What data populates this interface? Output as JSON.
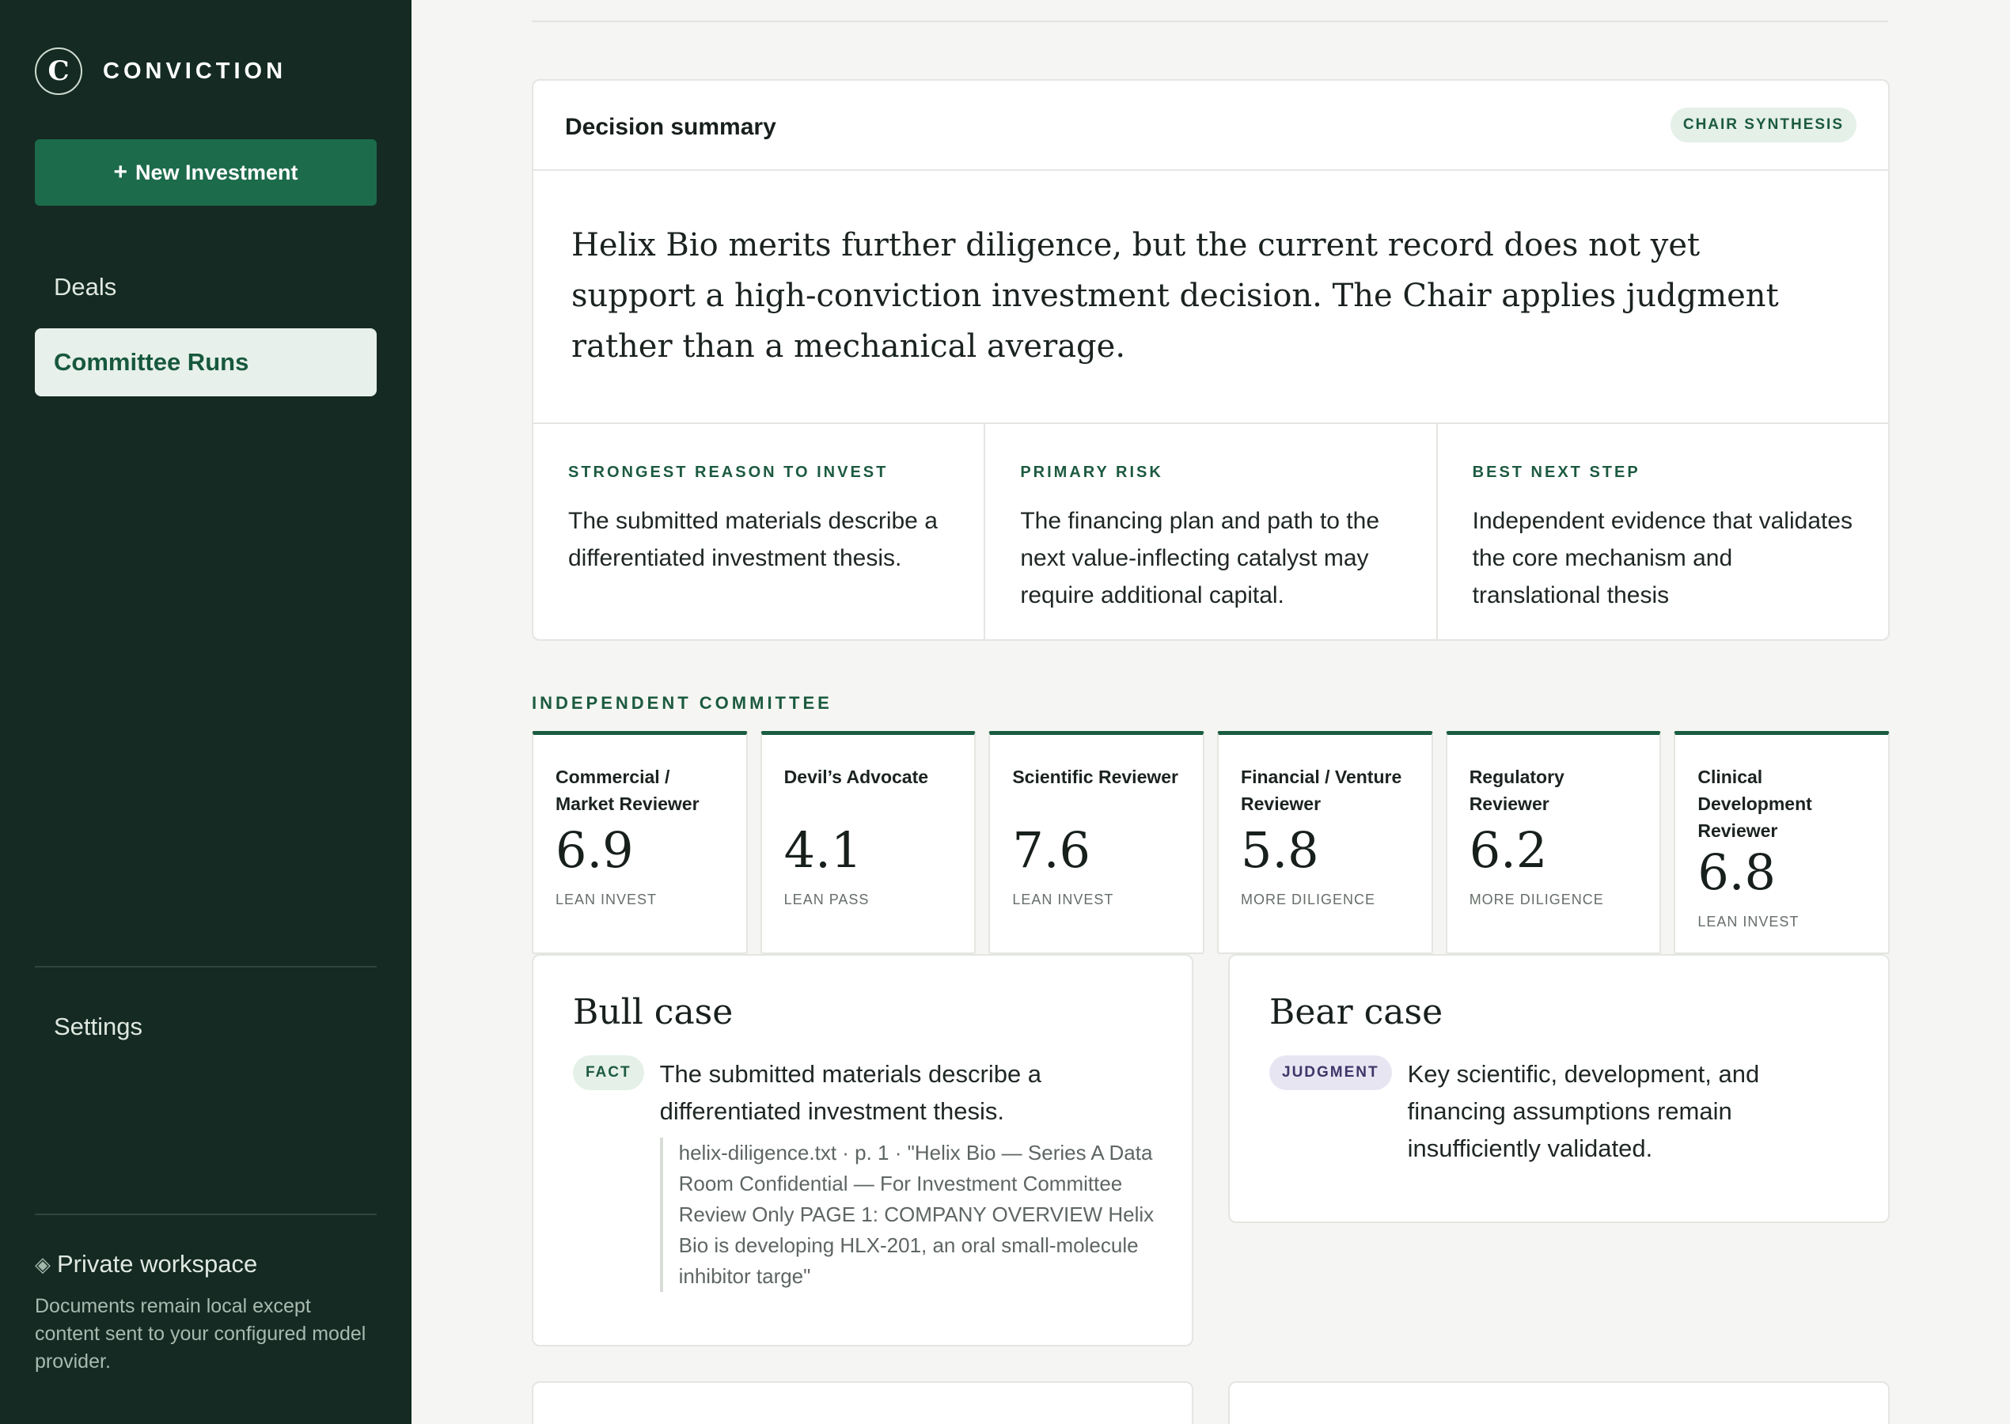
{
  "brand": {
    "mark": "C",
    "name": "CONVICTION"
  },
  "sidebar": {
    "new_button": "New Investment",
    "new_button_icon": "plus-icon",
    "nav": [
      {
        "label": "Deals",
        "active": false
      },
      {
        "label": "Committee Runs",
        "active": true
      }
    ],
    "settings": "Settings",
    "privacy": {
      "icon": "diamond-icon",
      "title": "Private workspace",
      "text": "Documents remain local except content sent to your configured model provider."
    }
  },
  "decision": {
    "title": "Decision summary",
    "badge": "CHAIR SYNTHESIS",
    "summary": "Helix Bio merits further diligence, but the current record does not yet support a high-conviction investment decision. The Chair applies judgment rather than a mechanical average.",
    "columns": [
      {
        "label": "STRONGEST REASON TO INVEST",
        "text": "The submitted materials describe a differentiated investment thesis."
      },
      {
        "label": "PRIMARY RISK",
        "text": "The financing plan and path to the next value-inflecting catalyst may require additional capital."
      },
      {
        "label": "BEST NEXT STEP",
        "text": "Independent evidence that validates the core mechanism and translational thesis"
      }
    ]
  },
  "committee": {
    "label": "INDEPENDENT COMMITTEE",
    "reviewers": [
      {
        "name": "Commercial / Market Reviewer",
        "score": "6.9",
        "verdict": "LEAN INVEST"
      },
      {
        "name": "Devil’s Advocate",
        "score": "4.1",
        "verdict": "LEAN PASS"
      },
      {
        "name": "Scientific Reviewer",
        "score": "7.6",
        "verdict": "LEAN INVEST"
      },
      {
        "name": "Financial / Venture Reviewer",
        "score": "5.8",
        "verdict": "MORE DILIGENCE"
      },
      {
        "name": "Regulatory Reviewer",
        "score": "6.2",
        "verdict": "MORE DILIGENCE"
      },
      {
        "name": "Clinical Development Reviewer",
        "score": "6.8",
        "verdict": "LEAN INVEST"
      }
    ]
  },
  "bull": {
    "title": "Bull case",
    "tag": "FACT",
    "text": "The submitted materials describe a differentiated investment thesis.",
    "quote": "helix-diligence.txt · p. 1 · \"Helix Bio — Series A Data Room Confidential — For Investment Committee Review Only PAGE 1: COMPANY OVERVIEW Helix Bio is developing HLX-201, an oral small-molecule inhibitor targe\""
  },
  "bear": {
    "title": "Bear case",
    "tag": "JUDGMENT",
    "text": "Key scientific, development, and financing assumptions remain insufficiently validated."
  }
}
